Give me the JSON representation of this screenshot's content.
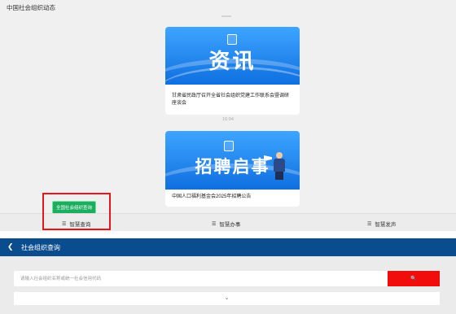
{
  "top_screen": {
    "title": "中国社会组织动态",
    "cards": [
      {
        "banner_text": "资讯",
        "description": "甘肃省民政厅召开全省社会组织党建工作联系会暨调研座谈会"
      },
      {
        "banner_text": "招聘启事",
        "description": "中国人口福利基金会2025年招聘公告"
      }
    ],
    "time_label": "16:04",
    "search_tag": "全国社会组织查询",
    "nav": [
      {
        "label": "智慧查询",
        "icon": "menu-icon"
      },
      {
        "label": "智慧办事",
        "icon": "menu-icon"
      },
      {
        "label": "智慧发声",
        "icon": "menu-icon"
      }
    ]
  },
  "bottom_screen": {
    "header_title": "社会组织查询",
    "back_icon": "chevron-left-icon",
    "search_placeholder": "请输入社会组织名称或统一社会信用代码",
    "search_button": "🔍",
    "expand_icon": "chevron-down-icon"
  },
  "colors": {
    "header_blue": "#0a4d8f",
    "search_red": "#f20d0d",
    "tag_green": "#1bae5e",
    "highlight_red": "#e8161a"
  }
}
